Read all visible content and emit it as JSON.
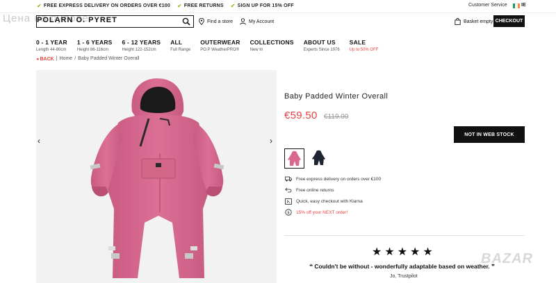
{
  "promo": {
    "items": [
      "FREE EXPRESS DELIVERY ON ORDERS OVER €100",
      "FREE RETURNS",
      "SIGN UP FOR 15% OFF"
    ],
    "customer_service": "Customer Service",
    "country": "IE"
  },
  "header": {
    "watermark": "Цена на пулове",
    "logo": "POLARN O. PYRET",
    "find_store": "Find a store",
    "my_account": "My Account",
    "basket": "Basket empty",
    "checkout": "CHECKOUT"
  },
  "nav": [
    {
      "title": "0 - 1 YEAR",
      "sub": "Length 44-80cm"
    },
    {
      "title": "1 - 6 YEARS",
      "sub": "Height 86-116cm"
    },
    {
      "title": "6 - 12 YEARS",
      "sub": "Height 122-152cm"
    },
    {
      "title": "ALL",
      "sub": "Full Range"
    },
    {
      "title": "OUTERWEAR",
      "sub": "PO.P WeatherPRO®"
    },
    {
      "title": "COLLECTIONS",
      "sub": "New In"
    },
    {
      "title": "ABOUT US",
      "sub": "Experts Since 1976"
    },
    {
      "title": "SALE",
      "sub": "Up to 50% OFF"
    }
  ],
  "breadcrumb": {
    "back": "◂ BACK",
    "sep": "|",
    "home": "Home",
    "slash": "/",
    "current": "Baby Padded Winter Overall"
  },
  "gallery": {
    "prev": "‹",
    "next": "›"
  },
  "product": {
    "title": "Baby Padded Winter Overall",
    "price": "€59.50",
    "old_price": "€119.00",
    "stock_button": "NOT IN WEB STOCK",
    "main_color": "#d9678f"
  },
  "features": [
    "Free express delivery on orders over €100",
    "Free online returns",
    "Quick, easy checkout with Klarna",
    "15% off your NEXT order!"
  ],
  "review": {
    "stars": [
      "★",
      "★",
      "★",
      "★",
      "★"
    ],
    "quote": "❝ Couldn't be without - wonderfully adaptable based on weather. ❞",
    "reviewer": "Jo, Trustpilot"
  },
  "watermark_bottom": "BAZAR"
}
